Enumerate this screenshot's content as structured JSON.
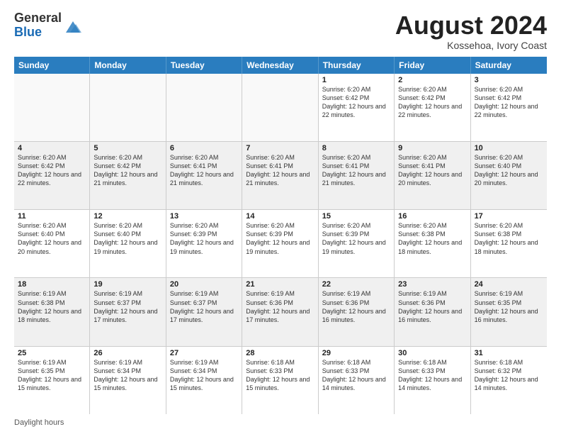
{
  "header": {
    "logo_general": "General",
    "logo_blue": "Blue",
    "month_year": "August 2024",
    "location": "Kossehoa, Ivory Coast"
  },
  "days_of_week": [
    "Sunday",
    "Monday",
    "Tuesday",
    "Wednesday",
    "Thursday",
    "Friday",
    "Saturday"
  ],
  "weeks": [
    [
      {
        "day": "",
        "empty": true
      },
      {
        "day": "",
        "empty": true
      },
      {
        "day": "",
        "empty": true
      },
      {
        "day": "",
        "empty": true
      },
      {
        "day": "1",
        "sunrise": "6:20 AM",
        "sunset": "6:42 PM",
        "daylight": "12 hours and 22 minutes."
      },
      {
        "day": "2",
        "sunrise": "6:20 AM",
        "sunset": "6:42 PM",
        "daylight": "12 hours and 22 minutes."
      },
      {
        "day": "3",
        "sunrise": "6:20 AM",
        "sunset": "6:42 PM",
        "daylight": "12 hours and 22 minutes."
      }
    ],
    [
      {
        "day": "4",
        "sunrise": "6:20 AM",
        "sunset": "6:42 PM",
        "daylight": "12 hours and 22 minutes."
      },
      {
        "day": "5",
        "sunrise": "6:20 AM",
        "sunset": "6:42 PM",
        "daylight": "12 hours and 21 minutes."
      },
      {
        "day": "6",
        "sunrise": "6:20 AM",
        "sunset": "6:41 PM",
        "daylight": "12 hours and 21 minutes."
      },
      {
        "day": "7",
        "sunrise": "6:20 AM",
        "sunset": "6:41 PM",
        "daylight": "12 hours and 21 minutes."
      },
      {
        "day": "8",
        "sunrise": "6:20 AM",
        "sunset": "6:41 PM",
        "daylight": "12 hours and 21 minutes."
      },
      {
        "day": "9",
        "sunrise": "6:20 AM",
        "sunset": "6:41 PM",
        "daylight": "12 hours and 20 minutes."
      },
      {
        "day": "10",
        "sunrise": "6:20 AM",
        "sunset": "6:40 PM",
        "daylight": "12 hours and 20 minutes."
      }
    ],
    [
      {
        "day": "11",
        "sunrise": "6:20 AM",
        "sunset": "6:40 PM",
        "daylight": "12 hours and 20 minutes."
      },
      {
        "day": "12",
        "sunrise": "6:20 AM",
        "sunset": "6:40 PM",
        "daylight": "12 hours and 19 minutes."
      },
      {
        "day": "13",
        "sunrise": "6:20 AM",
        "sunset": "6:39 PM",
        "daylight": "12 hours and 19 minutes."
      },
      {
        "day": "14",
        "sunrise": "6:20 AM",
        "sunset": "6:39 PM",
        "daylight": "12 hours and 19 minutes."
      },
      {
        "day": "15",
        "sunrise": "6:20 AM",
        "sunset": "6:39 PM",
        "daylight": "12 hours and 19 minutes."
      },
      {
        "day": "16",
        "sunrise": "6:20 AM",
        "sunset": "6:38 PM",
        "daylight": "12 hours and 18 minutes."
      },
      {
        "day": "17",
        "sunrise": "6:20 AM",
        "sunset": "6:38 PM",
        "daylight": "12 hours and 18 minutes."
      }
    ],
    [
      {
        "day": "18",
        "sunrise": "6:19 AM",
        "sunset": "6:38 PM",
        "daylight": "12 hours and 18 minutes."
      },
      {
        "day": "19",
        "sunrise": "6:19 AM",
        "sunset": "6:37 PM",
        "daylight": "12 hours and 17 minutes."
      },
      {
        "day": "20",
        "sunrise": "6:19 AM",
        "sunset": "6:37 PM",
        "daylight": "12 hours and 17 minutes."
      },
      {
        "day": "21",
        "sunrise": "6:19 AM",
        "sunset": "6:36 PM",
        "daylight": "12 hours and 17 minutes."
      },
      {
        "day": "22",
        "sunrise": "6:19 AM",
        "sunset": "6:36 PM",
        "daylight": "12 hours and 16 minutes."
      },
      {
        "day": "23",
        "sunrise": "6:19 AM",
        "sunset": "6:36 PM",
        "daylight": "12 hours and 16 minutes."
      },
      {
        "day": "24",
        "sunrise": "6:19 AM",
        "sunset": "6:35 PM",
        "daylight": "12 hours and 16 minutes."
      }
    ],
    [
      {
        "day": "25",
        "sunrise": "6:19 AM",
        "sunset": "6:35 PM",
        "daylight": "12 hours and 15 minutes."
      },
      {
        "day": "26",
        "sunrise": "6:19 AM",
        "sunset": "6:34 PM",
        "daylight": "12 hours and 15 minutes."
      },
      {
        "day": "27",
        "sunrise": "6:19 AM",
        "sunset": "6:34 PM",
        "daylight": "12 hours and 15 minutes."
      },
      {
        "day": "28",
        "sunrise": "6:18 AM",
        "sunset": "6:33 PM",
        "daylight": "12 hours and 15 minutes."
      },
      {
        "day": "29",
        "sunrise": "6:18 AM",
        "sunset": "6:33 PM",
        "daylight": "12 hours and 14 minutes."
      },
      {
        "day": "30",
        "sunrise": "6:18 AM",
        "sunset": "6:33 PM",
        "daylight": "12 hours and 14 minutes."
      },
      {
        "day": "31",
        "sunrise": "6:18 AM",
        "sunset": "6:32 PM",
        "daylight": "12 hours and 14 minutes."
      }
    ]
  ],
  "footer": {
    "label": "Daylight hours"
  }
}
